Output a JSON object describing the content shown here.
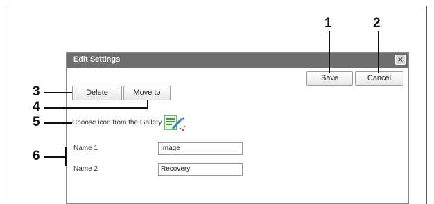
{
  "dialog": {
    "title": "Edit Settings",
    "close_label": "×",
    "save_label": "Save",
    "cancel_label": "Cancel",
    "delete_label": "Delete",
    "move_to_label": "Move to",
    "gallery_label": "Choose icon from the Gallery",
    "gallery_icon": "edit-picture-icon",
    "name1_label": "Name 1",
    "name1_value": "Image",
    "name2_label": "Name 2",
    "name2_value": "Recovery"
  },
  "callouts": [
    "1",
    "2",
    "3",
    "4",
    "5",
    "6"
  ]
}
